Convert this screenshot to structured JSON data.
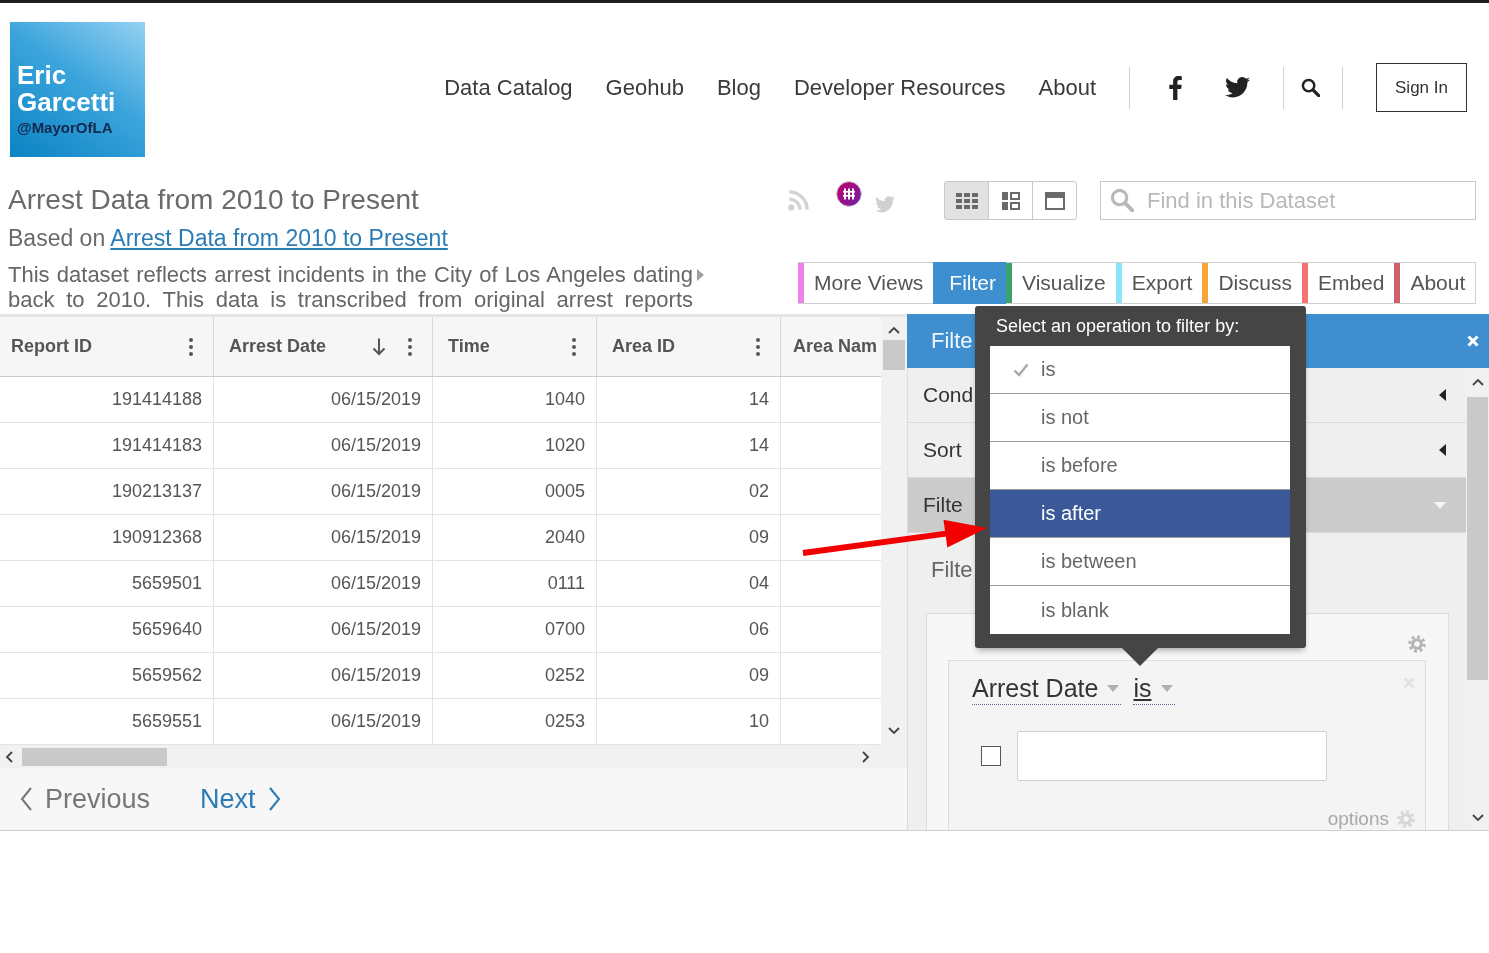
{
  "logo": {
    "name": "Eric Garcetti",
    "handle": "@MayorOfLA"
  },
  "nav": {
    "links": [
      "Data Catalog",
      "Geohub",
      "Blog",
      "Developer Resources",
      "About"
    ],
    "sign_in": "Sign In"
  },
  "dataset": {
    "title": "Arrest Data from 2010 to Present",
    "based_on": {
      "prefix": "Based on",
      "link": "Arrest Data from 2010 to Present"
    },
    "description": "This dataset reflects arrest incidents in the City of Los Angeles dating back to 2010. This data is transcribed from original arrest reports"
  },
  "view_modes": [
    {
      "kind": "grid",
      "selected": true
    },
    {
      "kind": "list",
      "selected": false
    },
    {
      "kind": "page",
      "selected": false
    }
  ],
  "search": {
    "placeholder": "Find in this Dataset"
  },
  "tabs": [
    {
      "label": "More Views",
      "color": "#ee82e6",
      "selected": false
    },
    {
      "label": "Filter",
      "color": "#3d8fd0",
      "selected": true
    },
    {
      "label": "Visualize",
      "color": "#3aa36a",
      "selected": false
    },
    {
      "label": "Export",
      "color": "#8ce4f8",
      "selected": false
    },
    {
      "label": "Discuss",
      "color": "#f7a535",
      "selected": false
    },
    {
      "label": "Embed",
      "color": "#f47272",
      "selected": false
    },
    {
      "label": "About",
      "color": "#d05f6d",
      "selected": false
    }
  ],
  "table": {
    "columns": [
      {
        "label": "Report ID",
        "sorted_descending": false,
        "menu": true
      },
      {
        "label": "Arrest Date",
        "sorted_descending": true,
        "menu": true
      },
      {
        "label": "Time",
        "sorted_descending": false,
        "menu": true
      },
      {
        "label": "Area ID",
        "sorted_descending": false,
        "menu": true
      },
      {
        "label": "Area Nam",
        "sorted_descending": false,
        "menu": false
      }
    ],
    "rows": [
      [
        "191414188",
        "06/15/2019",
        "1040",
        "14"
      ],
      [
        "191414183",
        "06/15/2019",
        "1020",
        "14"
      ],
      [
        "190213137",
        "06/15/2019",
        "0005",
        "02"
      ],
      [
        "190912368",
        "06/15/2019",
        "2040",
        "09"
      ],
      [
        "5659501",
        "06/15/2019",
        "0111",
        "04"
      ],
      [
        "5659640",
        "06/15/2019",
        "0700",
        "06"
      ],
      [
        "5659562",
        "06/15/2019",
        "0252",
        "09"
      ],
      [
        "5659551",
        "06/15/2019",
        "0253",
        "10"
      ]
    ]
  },
  "pager": {
    "previous": {
      "label": "Previous",
      "disabled": true
    },
    "next": {
      "label": "Next",
      "disabled": false
    }
  },
  "panel": {
    "title": "Filte",
    "sections": [
      {
        "label": "Cond",
        "expanded": false
      },
      {
        "label": "Sort",
        "expanded": false
      },
      {
        "label": "Filte",
        "expanded": true
      }
    ],
    "filter": {
      "label": "Filte",
      "condition": {
        "column": "Arrest Date",
        "operator": "is",
        "checked": false
      },
      "options_label": "options"
    }
  },
  "popover": {
    "title": "Select an operation to filter by:",
    "operations": [
      {
        "label": "is",
        "checked": true,
        "selected": false
      },
      {
        "label": "is not",
        "checked": false,
        "selected": false
      },
      {
        "label": "is before",
        "checked": false,
        "selected": false
      },
      {
        "label": "is after",
        "checked": false,
        "selected": true
      },
      {
        "label": "is between",
        "checked": false,
        "selected": false
      },
      {
        "label": "is blank",
        "checked": false,
        "selected": false
      }
    ]
  },
  "annotation": {
    "kind": "arrow"
  }
}
